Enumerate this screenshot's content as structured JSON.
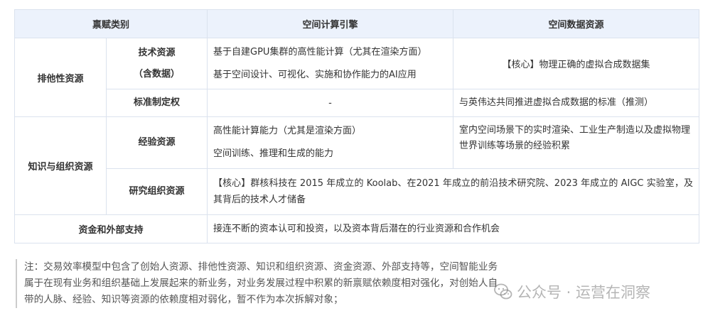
{
  "table": {
    "headers": [
      "禀赋类别",
      "空间计算引擎",
      "空间数据资源"
    ],
    "groups": {
      "exclusive": "排他性资源",
      "knowledge": "知识与组织资源",
      "capital": "资金和外部支持"
    },
    "rows": {
      "tech": {
        "label_line1": "技术资源",
        "label_line2": "（含数据）",
        "engine_line1": "基于自建GPU集群的高性能计算（尤其在渲染方面）",
        "engine_line2": "基于空间设计、可视化、实施和协作能力的AI应用",
        "data": "【核心】物理正确的虚拟合成数据集"
      },
      "standard": {
        "label": "标准制定权",
        "engine": "-",
        "data": "与英伟达共同推进虚拟合成数据的标准（推测）"
      },
      "experience": {
        "label": "经验资源",
        "engine_line1": "高性能计算能力（尤其是渲染方面）",
        "engine_line2": "空间训练、推理和生成的能力",
        "data": "室内空间场景下的实时渲染、工业生产制造以及虚拟物理世界训练等场景的经验积累"
      },
      "research": {
        "label": "研究组织资源",
        "text": "【核心】群核科技在 2015 年成立的 Koolab、在2021 年成立的前沿技术研究院、2023 年成立的 AIGC 实验室，及其背后的技术人才储备"
      },
      "capital": {
        "text": "接连不断的资本认可和投资，以及资本背后潜在的行业资源和合作机会"
      }
    }
  },
  "note": {
    "line1": "注：交易效率模型中包含了创始人资源、排他性资源、知识和组织资源、资金资源、外部支持等，空间智能业务",
    "line2": "属于在现有业务和组织基础上发展起来的新业务，对业务发展过程中积累的新禀赋依赖度相对强化，对创始人自",
    "line3": "带的人脉、经验、知识等资源的依赖度相对弱化，暂不作为本次拆解对象；"
  },
  "watermark": {
    "icon": "wechat-icon",
    "text": "公众号 · 运营在洞察"
  }
}
